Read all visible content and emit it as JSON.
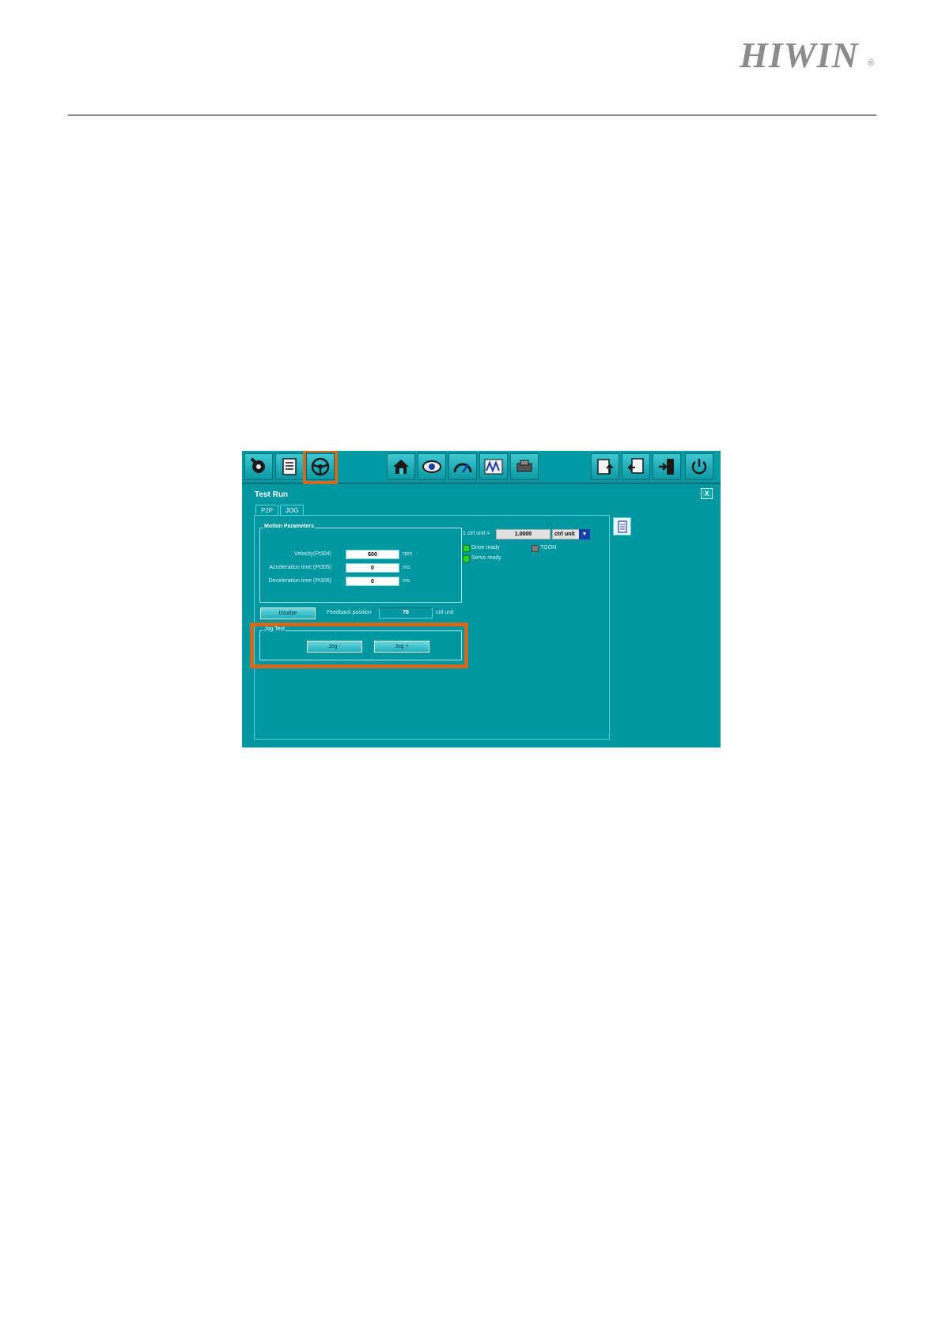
{
  "header": {
    "logo_text": "HIWIN",
    "logo_reg": "®"
  },
  "toolbar": {
    "icons": [
      "wrench-gear-icon",
      "parameter-list-icon",
      "steering-wheel-icon",
      "home-icon",
      "eye-icon",
      "gauge-icon",
      "waveform-icon",
      "drive-module-icon",
      "upload-document-icon",
      "download-document-icon",
      "exit-door-icon",
      "power-reset-icon"
    ],
    "highlight_color": "#d2691e"
  },
  "panel": {
    "title": "Test Run",
    "close_label": "X",
    "tabs": [
      {
        "label": "P2P",
        "active": false
      },
      {
        "label": "JOG",
        "active": true
      }
    ]
  },
  "motion_parameters": {
    "group_label": "Motion Parameters",
    "rows": [
      {
        "label": "Velocity(Pt304)",
        "value": "600",
        "unit": "rpm"
      },
      {
        "label": "Acceleration time (Pt305)",
        "value": "0",
        "unit": "ms"
      },
      {
        "label": "Deceleration time (Pt306)",
        "value": "0",
        "unit": "ms"
      }
    ]
  },
  "unit": {
    "label": "1 ctrl unit =",
    "value": "1.0000",
    "select_value": "ctrl unit",
    "arrow": "▼"
  },
  "status": [
    {
      "label": "Drive ready",
      "color": "#22d12a"
    },
    {
      "label": "TGON",
      "color": "#7a7a7a"
    },
    {
      "label": "Servo ready",
      "color": "#22d12a"
    }
  ],
  "servo": {
    "disable_label": "Disable",
    "feedback_label": "Feedback position",
    "feedback_value": "78",
    "feedback_unit": "ctrl unit"
  },
  "jog_test": {
    "group_label": "Jog Test",
    "jog_minus_label": "Jog -",
    "jog_plus_label": "Jog +",
    "highlight_color": "#d2691e"
  }
}
